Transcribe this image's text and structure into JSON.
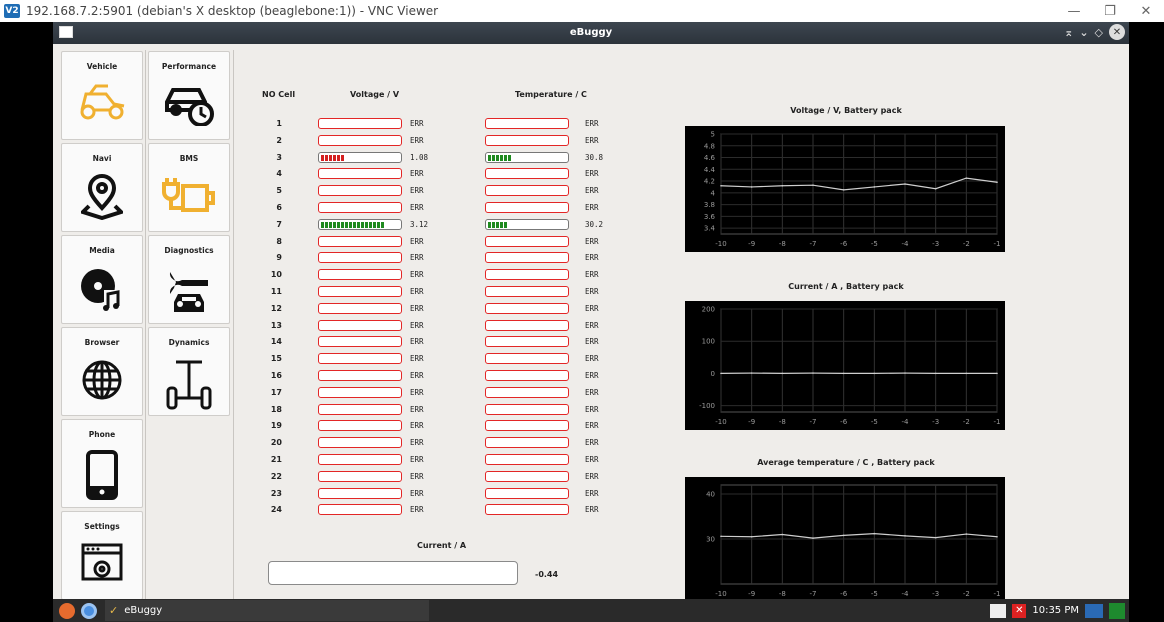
{
  "vnc": {
    "title": "192.168.7.2:5901 (debian's X desktop (beaglebone:1)) - VNC Viewer",
    "logo": "V2"
  },
  "app": {
    "title": "eBuggy"
  },
  "nav": {
    "left": [
      {
        "label": "Vehicle",
        "icon": "buggy-icon"
      },
      {
        "label": "Navi",
        "icon": "location-pin-icon"
      },
      {
        "label": "Media",
        "icon": "music-disc-icon"
      },
      {
        "label": "Browser",
        "icon": "globe-icon"
      },
      {
        "label": "Phone",
        "icon": "phone-icon"
      },
      {
        "label": "Settings",
        "icon": "settings-icon"
      }
    ],
    "right": [
      {
        "label": "Performance",
        "icon": "car-gauge-icon"
      },
      {
        "label": "BMS",
        "icon": "battery-plug-icon"
      },
      {
        "label": "Diagnostics",
        "icon": "wrench-car-icon"
      },
      {
        "label": "Dynamics",
        "icon": "segway-icon"
      }
    ]
  },
  "table": {
    "headers": {
      "cell": "NO Cell",
      "voltage": "Voltage / V",
      "temperature": "Temperature / C"
    },
    "rows": [
      {
        "no": "1",
        "v": "ERR",
        "t": "ERR"
      },
      {
        "no": "2",
        "v": "ERR",
        "t": "ERR"
      },
      {
        "no": "3",
        "v": "1.08",
        "t": "30.8",
        "vfill": 0.35,
        "tfill": 0.35,
        "vcolor": "#d42020",
        "tcolor": "#1f8a1f"
      },
      {
        "no": "4",
        "v": "ERR",
        "t": "ERR"
      },
      {
        "no": "5",
        "v": "ERR",
        "t": "ERR"
      },
      {
        "no": "6",
        "v": "ERR",
        "t": "ERR"
      },
      {
        "no": "7",
        "v": "3.12",
        "t": "30.2",
        "vfill": 0.9,
        "tfill": 0.3,
        "vcolor": "#1f8a1f",
        "tcolor": "#1f8a1f"
      },
      {
        "no": "8",
        "v": "ERR",
        "t": "ERR"
      },
      {
        "no": "9",
        "v": "ERR",
        "t": "ERR"
      },
      {
        "no": "10",
        "v": "ERR",
        "t": "ERR"
      },
      {
        "no": "11",
        "v": "ERR",
        "t": "ERR"
      },
      {
        "no": "12",
        "v": "ERR",
        "t": "ERR"
      },
      {
        "no": "13",
        "v": "ERR",
        "t": "ERR"
      },
      {
        "no": "14",
        "v": "ERR",
        "t": "ERR"
      },
      {
        "no": "15",
        "v": "ERR",
        "t": "ERR"
      },
      {
        "no": "16",
        "v": "ERR",
        "t": "ERR"
      },
      {
        "no": "17",
        "v": "ERR",
        "t": "ERR"
      },
      {
        "no": "18",
        "v": "ERR",
        "t": "ERR"
      },
      {
        "no": "19",
        "v": "ERR",
        "t": "ERR"
      },
      {
        "no": "20",
        "v": "ERR",
        "t": "ERR"
      },
      {
        "no": "21",
        "v": "ERR",
        "t": "ERR"
      },
      {
        "no": "22",
        "v": "ERR",
        "t": "ERR"
      },
      {
        "no": "23",
        "v": "ERR",
        "t": "ERR"
      },
      {
        "no": "24",
        "v": "ERR",
        "t": "ERR"
      }
    ]
  },
  "current": {
    "label": "Current / A",
    "value": "-0.44"
  },
  "chart_data": [
    {
      "type": "line",
      "title": "Voltage / V,  Battery pack",
      "x": [
        -10,
        -9,
        -8,
        -7,
        -6,
        -5,
        -4,
        -3,
        -2,
        -1
      ],
      "xticks": [
        "-10",
        "-9",
        "-8",
        "-7",
        "-6",
        "-5",
        "-4",
        "-3",
        "-2",
        "-1"
      ],
      "yticks": [
        "3.4",
        "3.6",
        "3.8",
        "4",
        "4.2",
        "4.4",
        "4.6",
        "4.8",
        "5"
      ],
      "ylim": [
        3.3,
        5
      ],
      "values": [
        4.12,
        4.1,
        4.12,
        4.13,
        4.05,
        4.1,
        4.15,
        4.07,
        4.25,
        4.18
      ],
      "line_color": "#cfcfcf",
      "grid": true
    },
    {
      "type": "line",
      "title": "Current / A ,  Battery pack",
      "x": [
        -10,
        -9,
        -8,
        -7,
        -6,
        -5,
        -4,
        -3,
        -2,
        -1
      ],
      "xticks": [
        "-10",
        "-9",
        "-8",
        "-7",
        "-6",
        "-5",
        "-4",
        "-3",
        "-2",
        "-1"
      ],
      "yticks": [
        "-100",
        "0",
        "100",
        "200"
      ],
      "ylim": [
        -120,
        200
      ],
      "values": [
        0,
        1,
        0,
        1,
        0,
        0,
        1,
        0,
        0,
        0
      ],
      "line_color": "#cfcfcf",
      "grid": true
    },
    {
      "type": "line",
      "title": "Average temperature / C ,  Battery pack",
      "x": [
        -10,
        -9,
        -8,
        -7,
        -6,
        -5,
        -4,
        -3,
        -2,
        -1
      ],
      "xticks": [
        "-10",
        "-9",
        "-8",
        "-7",
        "-6",
        "-5",
        "-4",
        "-3",
        "-2",
        "-1"
      ],
      "yticks": [
        "30",
        "40"
      ],
      "ylim": [
        20,
        42
      ],
      "values": [
        30.6,
        30.5,
        31,
        30.2,
        30.8,
        31.2,
        30.7,
        30.3,
        31.1,
        30.5
      ],
      "line_color": "#cfcfcf",
      "grid": true
    }
  ],
  "taskbar": {
    "task_label": "eBuggy",
    "clock": "10:35 PM"
  },
  "colors": {
    "err_border": "#e32626",
    "ok_green": "#1f8a1f",
    "low_red": "#d42020"
  }
}
